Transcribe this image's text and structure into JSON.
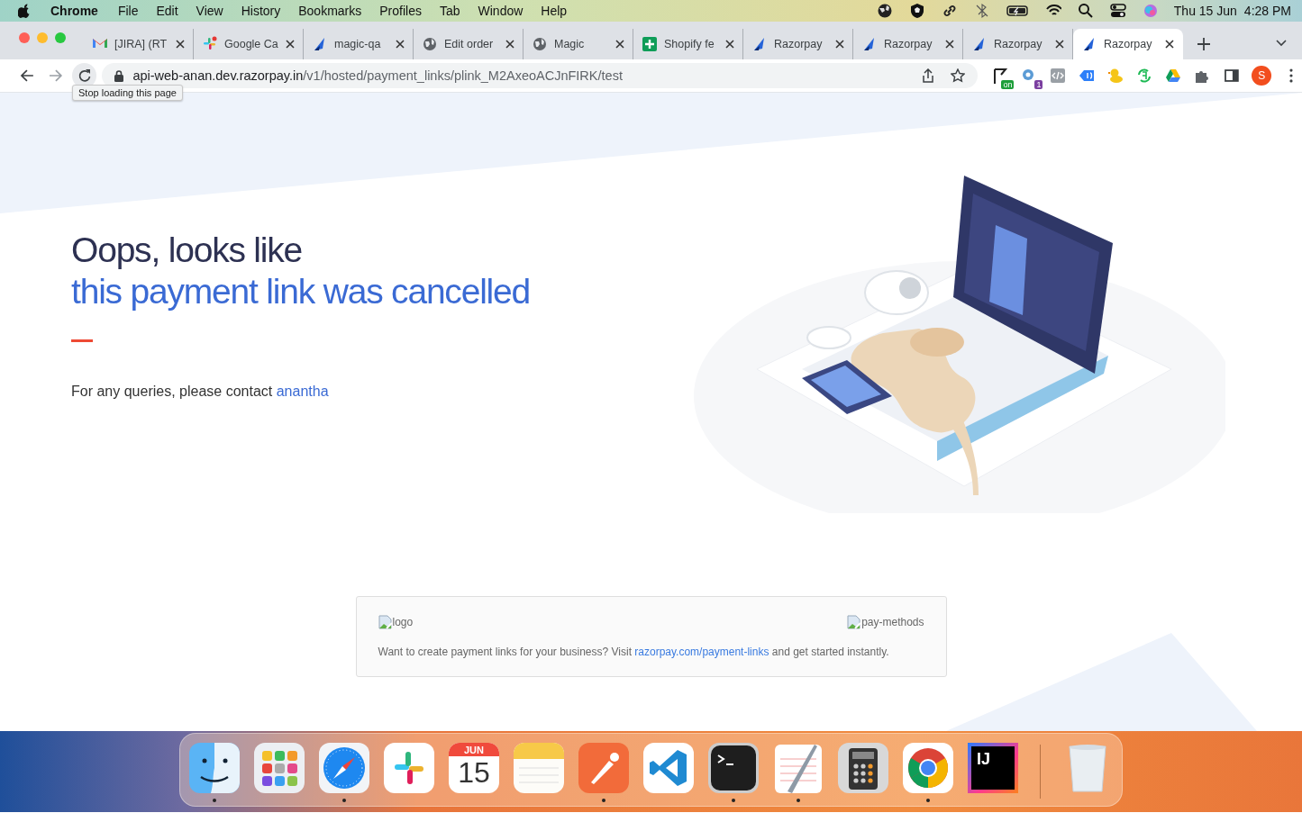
{
  "menu_bar": {
    "app_name": "Chrome",
    "menus": [
      "File",
      "Edit",
      "View",
      "History",
      "Bookmarks",
      "Profiles",
      "Tab",
      "Window",
      "Help"
    ],
    "date": "Thu 15 Jun",
    "time": "4:28 PM"
  },
  "tabs": [
    {
      "title": "[JIRA] (RT",
      "kind": "mail",
      "selected": false
    },
    {
      "title": "Google Ca",
      "kind": "pinwheel",
      "selected": false
    },
    {
      "title": "magic-qa",
      "kind": "feather",
      "selected": false
    },
    {
      "title": "Edit order",
      "kind": "globe",
      "selected": false
    },
    {
      "title": "Magic",
      "kind": "globe",
      "selected": false
    },
    {
      "title": "Shopify fe",
      "kind": "sheet",
      "selected": false
    },
    {
      "title": "Razorpay",
      "kind": "feather",
      "selected": false
    },
    {
      "title": "Razorpay",
      "kind": "feather",
      "selected": false
    },
    {
      "title": "Razorpay",
      "kind": "feather",
      "selected": false
    },
    {
      "title": "Razorpay",
      "kind": "feather",
      "selected": true
    }
  ],
  "toolbar": {
    "url_host": "api-web-anan.dev.razorpay.in",
    "url_path": "/v1/hosted/payment_links/plink_M2AxeoACJnFIRK/test",
    "tooltip": "Stop loading this page",
    "extensions": [
      {
        "kind": "flag",
        "badge": "on"
      },
      {
        "kind": "gear",
        "badge": "1"
      },
      {
        "kind": "code"
      },
      {
        "kind": "tag"
      },
      {
        "kind": "duck"
      },
      {
        "kind": "cycle"
      },
      {
        "kind": "triangle"
      },
      {
        "kind": "puzzle"
      }
    ],
    "profile_initial": "S"
  },
  "page": {
    "heading_line1": "Oops, looks like",
    "heading_line2": "this payment link was cancelled",
    "contact_text": "For any queries, please contact",
    "contact_link": "anantha",
    "footer": {
      "logo_alt": "logo",
      "methods_alt": "pay-methods",
      "text_before": "Want to create payment links for your business? Visit",
      "link": "razorpay.com/payment-links",
      "text_after": "and get started instantly."
    }
  },
  "dock": [
    {
      "kind": "finder",
      "running": true
    },
    {
      "kind": "launchpad",
      "running": false
    },
    {
      "kind": "safari",
      "running": true
    },
    {
      "kind": "slack",
      "running": false
    },
    {
      "kind": "calendar",
      "running": false,
      "month": "JUN",
      "day": "15"
    },
    {
      "kind": "notes",
      "running": false
    },
    {
      "kind": "postman",
      "running": true
    },
    {
      "kind": "vscode",
      "running": false
    },
    {
      "kind": "terminal",
      "running": true
    },
    {
      "kind": "textedit",
      "running": true
    },
    {
      "kind": "calculator",
      "running": false
    },
    {
      "kind": "chrome",
      "running": true
    },
    {
      "kind": "intellij",
      "running": false,
      "label": "IJ"
    },
    {
      "kind": "trash",
      "running": false
    }
  ]
}
